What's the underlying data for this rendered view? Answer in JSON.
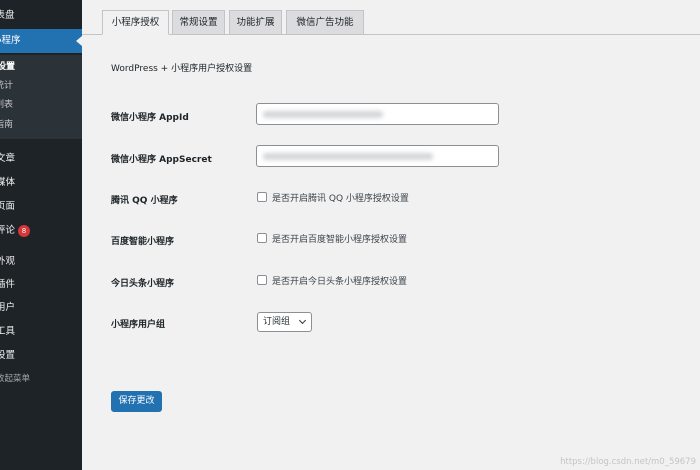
{
  "sidebar": {
    "items": [
      {
        "label": "仪表盘"
      },
      {
        "label": "小程序"
      },
      {
        "label": "文章"
      },
      {
        "label": "媒体"
      },
      {
        "label": "页面"
      },
      {
        "label": "评论"
      },
      {
        "label": "外观"
      },
      {
        "label": "插件"
      },
      {
        "label": "用户"
      },
      {
        "label": "工具"
      },
      {
        "label": "设置"
      }
    ],
    "submenu": [
      {
        "label": "设置"
      },
      {
        "label": "统计"
      },
      {
        "label": "列表"
      },
      {
        "label": "指南"
      }
    ],
    "comment_badge": "8",
    "collapse_label": "收起菜单"
  },
  "tabs": [
    {
      "label": "小程序授权"
    },
    {
      "label": "常规设置"
    },
    {
      "label": "功能扩展"
    },
    {
      "label": "微信广告功能"
    }
  ],
  "page": {
    "subtitle": "WordPress + 小程序用户授权设置"
  },
  "form": {
    "appid_label": "微信小程序 AppId",
    "appsecret_label": "微信小程序 AppSecret",
    "qq_label": "腾讯 QQ 小程序",
    "qq_checkbox": "是否开启腾讯 QQ 小程序授权设置",
    "baidu_label": "百度智能小程序",
    "baidu_checkbox": "是否开启百度智能小程序授权设置",
    "toutiao_label": "今日头条小程序",
    "toutiao_checkbox": "是否开启今日头条小程序授权设置",
    "group_label": "小程序用户组",
    "group_value": "订阅组",
    "save_label": "保存更改"
  },
  "watermark": "https://blog.csdn.net/m0_59679",
  "colors": {
    "sidebar_bg": "#1d2327",
    "accent": "#2271b1",
    "badge": "#d63638",
    "content_bg": "#f1f1f1"
  }
}
